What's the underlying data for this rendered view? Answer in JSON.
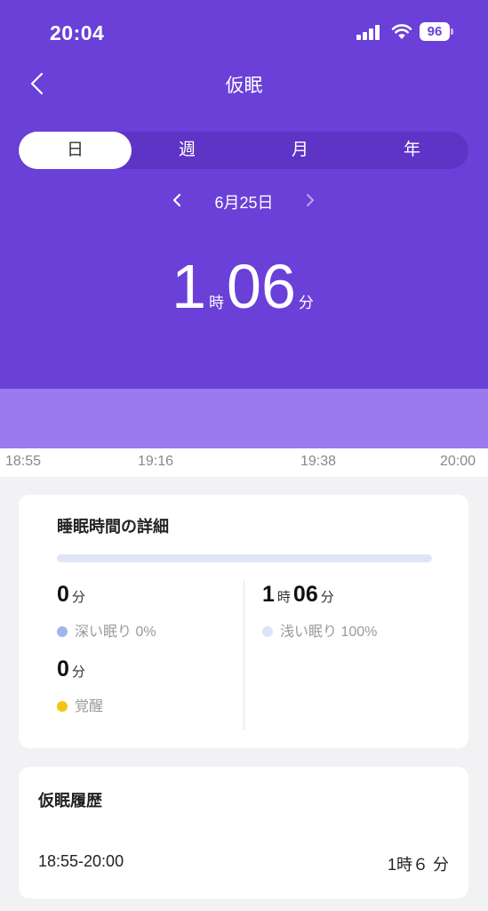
{
  "status": {
    "time": "20:04",
    "battery": "96"
  },
  "header": {
    "title": "仮眠"
  },
  "tabs": [
    {
      "label": "日",
      "active": true
    },
    {
      "label": "週",
      "active": false
    },
    {
      "label": "月",
      "active": false
    },
    {
      "label": "年",
      "active": false
    }
  ],
  "date": {
    "label": "6月25日"
  },
  "total": {
    "hours": "1",
    "hours_unit": "時",
    "minutes": "06",
    "minutes_unit": "分"
  },
  "timeline": {
    "ticks": [
      "18:55",
      "19:16",
      "19:38",
      "20:00"
    ]
  },
  "details": {
    "title": "睡眠時間の詳細",
    "deep": {
      "value": "0",
      "unit": "分",
      "label": "深い眠り 0%"
    },
    "light": {
      "hours": "1",
      "hours_unit": "時",
      "minutes": "06",
      "minutes_unit": "分",
      "label": "浅い眠り 100%"
    },
    "awake": {
      "value": "0",
      "unit": "分",
      "label": "覚醒"
    }
  },
  "history": {
    "title": "仮眠履歴",
    "items": [
      {
        "range": "18:55-20:00",
        "duration": "1時６ 分"
      }
    ]
  },
  "colors": {
    "primary": "#6a40d8",
    "segment_bg": "#5d34c6",
    "sleep_band": "#9a7aed",
    "deep": "#9fb5ee",
    "light": "#dce4f8",
    "awake": "#f5c311"
  }
}
